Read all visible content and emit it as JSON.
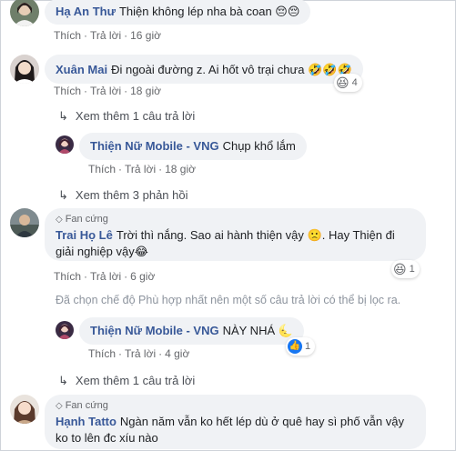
{
  "colors": {
    "link": "#385898",
    "bubble": "#f0f2f5",
    "meta": "#65676b"
  },
  "actions": {
    "like": "Thích",
    "reply": "Trả lời",
    "sep": "·"
  },
  "comments": [
    {
      "author": "Hạ An Thư",
      "text": "Thiện không lép nha bà coan",
      "emoji": "😔😔",
      "time": "16 giờ"
    },
    {
      "author": "Xuân Mai",
      "text": "Đi ngoài đường z. Ai hốt vô trại chưa",
      "emoji": "🤣🤣🤣",
      "time": "18 giờ",
      "reaction_count": "4",
      "reaction_icon": "haha-emoji",
      "more_replies": "Xem thêm 1 câu trả lời",
      "reply": {
        "author": "Thiện Nữ Mobile - VNG",
        "text": "Chụp khổ lắm",
        "time": "18 giờ"
      },
      "more_replies_2": "Xem thêm 3 phản hồi"
    },
    {
      "badge": "Fan cứng",
      "author": "Trai Họ Lê",
      "text": "Trời thì nắng. Sao ai hành thiện vậy",
      "emoji1": "🙁",
      "text2": ". Hay Thiện đi giải nghiệp vậy",
      "emoji2": "😂",
      "time": "6 giờ",
      "reaction_count": "1",
      "reaction_icon": "haha-emoji",
      "filter_note": "Đã chọn chế độ Phù hợp nhất nên một số câu trả lời có thể bị lọc ra.",
      "reply": {
        "author": "Thiện Nữ Mobile - VNG",
        "text": "NÀY NHÁ",
        "emoji": "🌜",
        "time": "4 giờ",
        "reaction_count": "1",
        "reaction_icon": "like-icon"
      },
      "more_replies": "Xem thêm 1 câu trả lời"
    },
    {
      "badge": "Fan cứng",
      "author": "Hạnh Tatto",
      "text": "Ngàn năm vẫn ko hết lép dù ở quê hay sì phố vẫn vậy ko to lên đc xíu nào"
    }
  ]
}
